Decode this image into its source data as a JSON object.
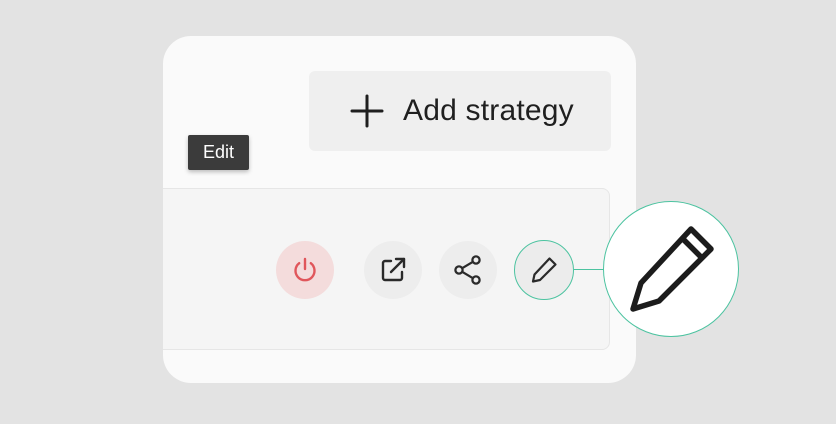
{
  "toolbar": {
    "add_strategy_label": "Add strategy"
  },
  "tooltip": {
    "text": "Edit"
  },
  "actions": {
    "power_icon": "power-icon",
    "open_icon": "external-link-icon",
    "share_icon": "share-icon",
    "edit_icon": "pencil-icon"
  },
  "colors": {
    "accent": "#4cc3a0",
    "danger": "#e0565b",
    "danger_bg": "#f4dcdc",
    "tooltip_bg": "#3b3b3b"
  }
}
